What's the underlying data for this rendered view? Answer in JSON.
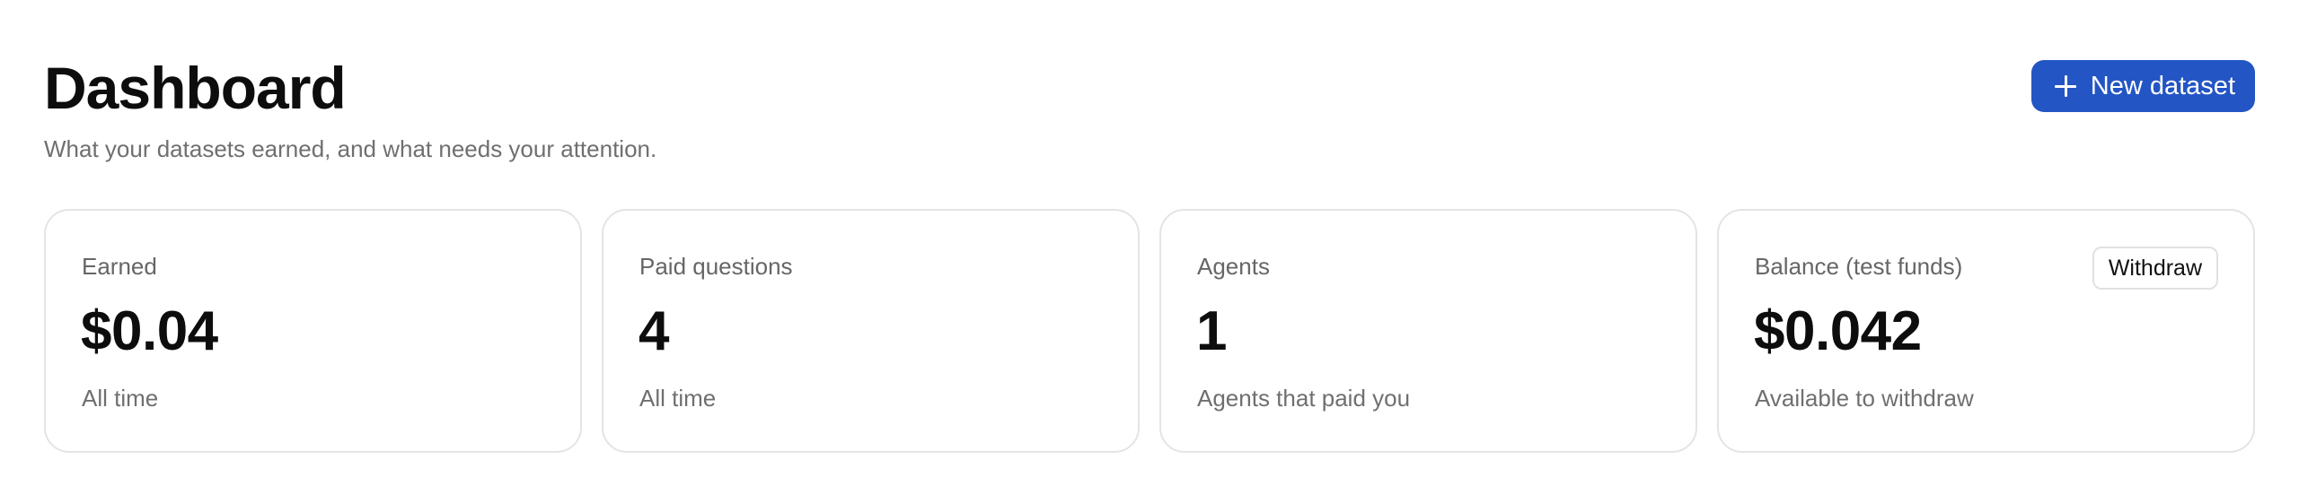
{
  "header": {
    "title": "Dashboard",
    "subtitle": "What your datasets earned, and what needs your attention.",
    "new_dataset_label": "New dataset",
    "new_dataset_icon": "plus-icon",
    "accent_color": "#2355c4"
  },
  "cards": [
    {
      "label": "Earned",
      "value": "$0.04",
      "caption": "All time"
    },
    {
      "label": "Paid questions",
      "value": "4",
      "caption": "All time"
    },
    {
      "label": "Agents",
      "value": "1",
      "caption": "Agents that paid you"
    },
    {
      "label": "Balance (test funds)",
      "value": "$0.042",
      "caption": "Available to withdraw",
      "action_label": "Withdraw"
    }
  ]
}
